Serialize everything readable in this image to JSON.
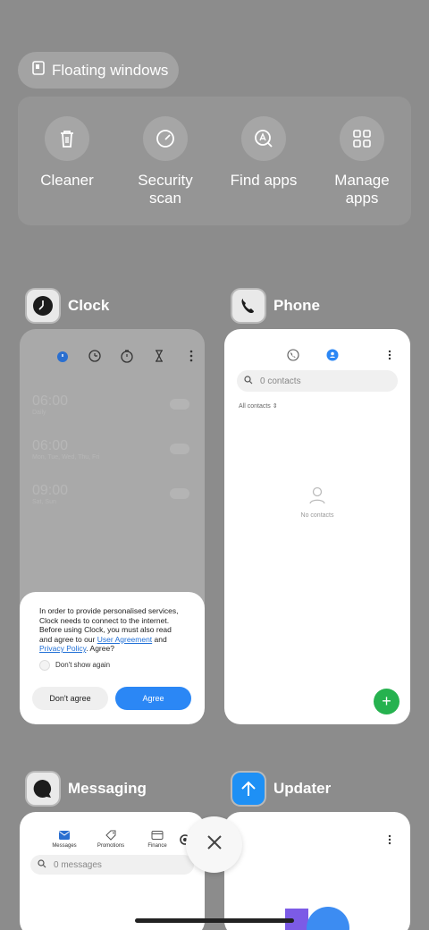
{
  "floating_windows": {
    "label": "Floating windows"
  },
  "quick_actions": [
    {
      "label": "Cleaner",
      "icon": "trash-icon"
    },
    {
      "label": "Security scan",
      "icon": "speedometer-icon"
    },
    {
      "label": "Find apps",
      "icon": "find-apps-icon"
    },
    {
      "label": "Manage apps",
      "icon": "grid-icon"
    }
  ],
  "apps": {
    "clock": {
      "name": "Clock",
      "alarms": [
        {
          "time": "06:00",
          "sub": "Daily"
        },
        {
          "time": "06:00",
          "sub": "Mon, Tue, Wed, Thu, Fri"
        },
        {
          "time": "09:00",
          "sub": "Sat, Sun"
        }
      ],
      "dialog": {
        "text_1": "In order to provide personalised services, Clock needs to connect to the internet. Before using Clock, you must also read and agree to our ",
        "link_1": "User Agreement",
        "text_2": " and ",
        "link_2": "Privacy Policy",
        "text_3": ". Agree?",
        "dont_show": "Don't show again",
        "disagree": "Don't agree",
        "agree": "Agree"
      }
    },
    "phone": {
      "name": "Phone",
      "search_placeholder": "0 contacts",
      "filter": "All contacts",
      "empty": "No contacts"
    },
    "messaging": {
      "name": "Messaging",
      "tabs": [
        "Messages",
        "Promotions",
        "Finance"
      ],
      "search_placeholder": "0 messages"
    },
    "updater": {
      "name": "Updater"
    }
  },
  "colors": {
    "background": "#8c8c8c",
    "accent_blue": "#2b87f5",
    "fab_green": "#26b24f"
  }
}
